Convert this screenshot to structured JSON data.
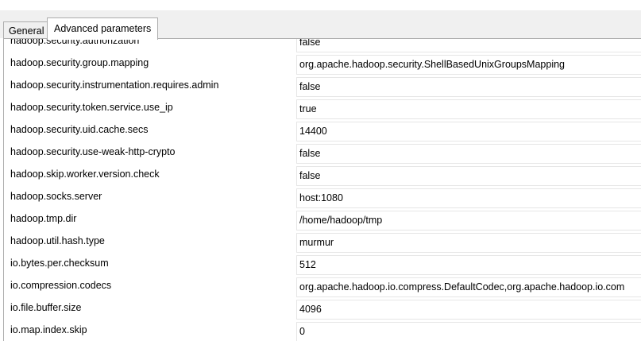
{
  "tabs": [
    {
      "label": "General"
    },
    {
      "label": "Advanced parameters"
    }
  ],
  "parameters": [
    {
      "name": "hadoop.security.authorization",
      "value": "false"
    },
    {
      "name": "hadoop.security.group.mapping",
      "value": "org.apache.hadoop.security.ShellBasedUnixGroupsMapping"
    },
    {
      "name": "hadoop.security.instrumentation.requires.admin",
      "value": "false"
    },
    {
      "name": "hadoop.security.token.service.use_ip",
      "value": "true"
    },
    {
      "name": "hadoop.security.uid.cache.secs",
      "value": "14400"
    },
    {
      "name": "hadoop.security.use-weak-http-crypto",
      "value": "false"
    },
    {
      "name": "hadoop.skip.worker.version.check",
      "value": "false"
    },
    {
      "name": "hadoop.socks.server",
      "value": "host:1080"
    },
    {
      "name": "hadoop.tmp.dir",
      "value": "/home/hadoop/tmp"
    },
    {
      "name": "hadoop.util.hash.type",
      "value": "murmur"
    },
    {
      "name": "io.bytes.per.checksum",
      "value": "512"
    },
    {
      "name": "io.compression.codecs",
      "value": "org.apache.hadoop.io.compress.DefaultCodec,org.apache.hadoop.io.com"
    },
    {
      "name": "io.file.buffer.size",
      "value": "4096"
    },
    {
      "name": "io.map.index.skip",
      "value": "0"
    }
  ]
}
